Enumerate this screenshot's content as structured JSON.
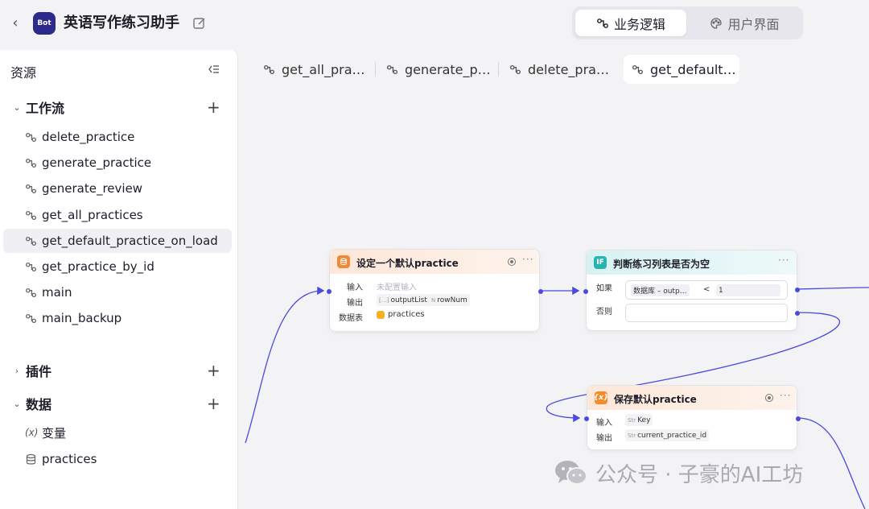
{
  "header": {
    "back_glyph": "‹",
    "avatar_text": "Bot",
    "title": "英语写作练习助手",
    "modes": [
      {
        "label": "业务逻辑",
        "icon": "workflow-icon"
      },
      {
        "label": "用户界面",
        "icon": "palette-icon"
      }
    ]
  },
  "sidebar": {
    "heading": "资源",
    "sections": {
      "workflow": {
        "label": "工作流",
        "expanded": true
      },
      "plugin": {
        "label": "插件",
        "expanded": false
      },
      "data": {
        "label": "数据",
        "expanded": true
      }
    },
    "workflows": [
      "delete_practice",
      "generate_practice",
      "generate_review",
      "get_all_practices",
      "get_default_practice_on_load",
      "get_practice_by_id",
      "main",
      "main_backup"
    ],
    "selected_workflow": "get_default_practice_on_load",
    "data_items": [
      {
        "glyph": "(x)",
        "label": "变量"
      },
      {
        "glyph": "db",
        "label": "practices"
      }
    ]
  },
  "tabs": [
    {
      "label": "get_all_pra…"
    },
    {
      "label": "generate_p…"
    },
    {
      "label": "delete_pra…"
    },
    {
      "label": "get_default…"
    }
  ],
  "nodes": {
    "set_default": {
      "title": "设定一个默认practice",
      "input_label": "输入",
      "input_placeholder": "未配置输入",
      "output_label": "输出",
      "outputs": [
        {
          "type": "[…]",
          "name": "outputList"
        },
        {
          "type": "N",
          "name": "rowNum"
        }
      ],
      "table_label": "数据表",
      "table_name": "practices"
    },
    "condition": {
      "icon_text": "IF",
      "title": "判断练习列表是否为空",
      "if_label": "如果",
      "else_label": "否则",
      "left_operand": "数据库 – outp…",
      "operator": "<",
      "right_operand": "1"
    },
    "save_default": {
      "icon_text": "{x}",
      "title": "保存默认practice",
      "input_label": "输入",
      "input_value": "Key",
      "input_type": "Str",
      "output_label": "输出",
      "output_value": "current_practice_id",
      "output_type": "Str"
    }
  },
  "watermark": {
    "text": "公众号 · 子豪的AI工坊"
  },
  "colors": {
    "accent": "#4a4adb",
    "avatar": "#2d2a8c",
    "db_node": "#ef8a3a",
    "if_node": "#2ab3b3",
    "var_node": "#f08c2b"
  }
}
